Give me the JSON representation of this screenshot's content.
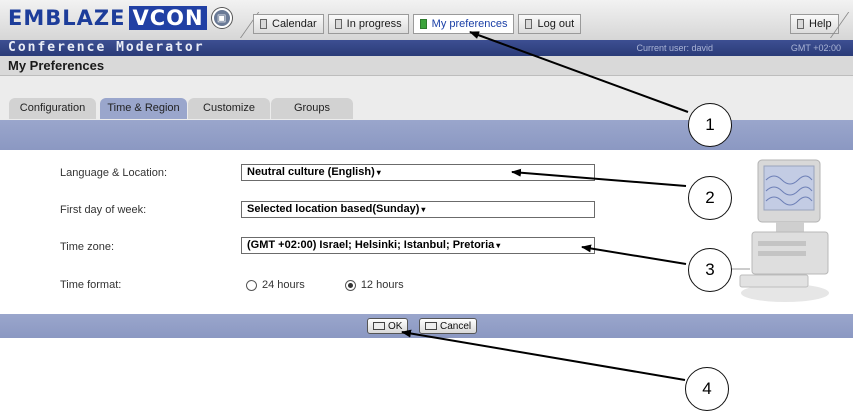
{
  "header": {
    "brand": "EMBLAZE",
    "brand_highlight": "VCON",
    "nav_tabs": [
      {
        "label": "Calendar",
        "active": false
      },
      {
        "label": "In progress",
        "active": false
      },
      {
        "label": "My preferences",
        "active": true
      },
      {
        "label": "Log out",
        "active": false
      }
    ],
    "help_label": "Help",
    "app_title": "Conference Moderator",
    "current_user": "Current user: david",
    "timezone": "GMT +02:00"
  },
  "page": {
    "title": "My Preferences",
    "tabs": [
      {
        "label": "Configuration",
        "active": false
      },
      {
        "label": "Time & Region",
        "active": true
      },
      {
        "label": "Customize",
        "active": false
      },
      {
        "label": "Groups",
        "active": false
      }
    ]
  },
  "form": {
    "language": {
      "label": "Language & Location:",
      "value": "Neutral culture (English)"
    },
    "first_day": {
      "label": "First day of week:",
      "value": "Selected location based(Sunday)"
    },
    "time_zone": {
      "label": "Time zone:",
      "value": "(GMT +02:00) Israel; Helsinki; Istanbul; Pretoria"
    },
    "time_format": {
      "label": "Time format:",
      "options": [
        {
          "label": "24 hours",
          "selected": false
        },
        {
          "label": "12 hours",
          "selected": true
        }
      ]
    }
  },
  "footer": {
    "ok_label": "OK",
    "cancel_label": "Cancel"
  },
  "callouts": [
    "1",
    "2",
    "3",
    "4"
  ],
  "colors": {
    "brand_blue": "#2140a4",
    "sub_bar": "#2f3f80",
    "strip": "#9aa6cc"
  }
}
